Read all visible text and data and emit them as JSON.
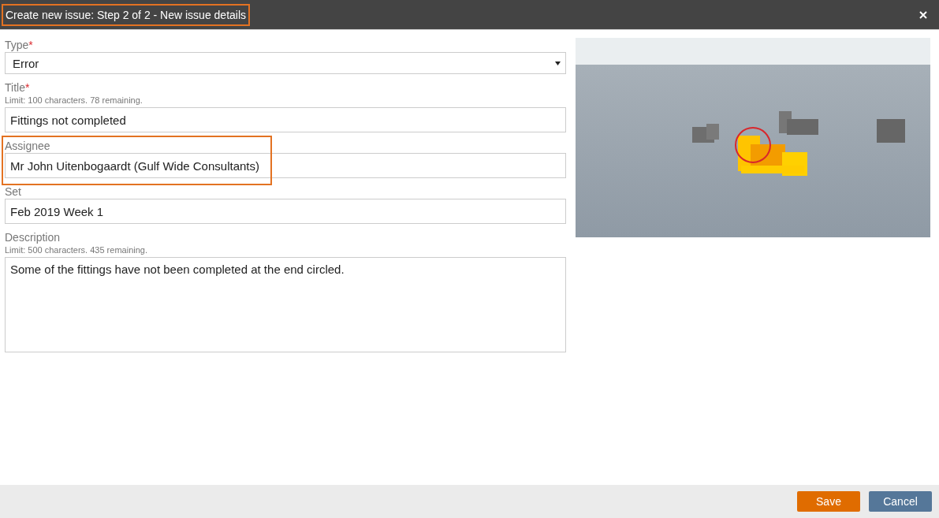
{
  "window": {
    "title": "Create new issue: Step 2 of 2 - New issue details",
    "title_highlighted": true
  },
  "fields": [
    {
      "kind": "select",
      "label": "Type",
      "required_mark": "*",
      "value": "Error",
      "highlighted": false
    },
    {
      "kind": "text",
      "label": "Title",
      "required_mark": "*",
      "hint": "Limit: 100 characters. 78 remaining.",
      "value": "Fittings not completed",
      "highlighted": false
    },
    {
      "kind": "text",
      "label": "Assignee",
      "value": "Mr John Uitenbogaardt (Gulf Wide Consultants)",
      "highlighted": true
    },
    {
      "kind": "text",
      "label": "Set",
      "value": "Feb 2019 Week 1",
      "highlighted": false
    },
    {
      "kind": "textarea",
      "label": "Description",
      "hint": "Limit: 500 characters. 435 remaining.",
      "value": "Some of the fittings have not been completed at the end circled.",
      "highlighted": false
    }
  ],
  "buttons": [
    {
      "label": "Save",
      "kind": "primary"
    },
    {
      "label": "Cancel",
      "kind": "secondary"
    }
  ]
}
